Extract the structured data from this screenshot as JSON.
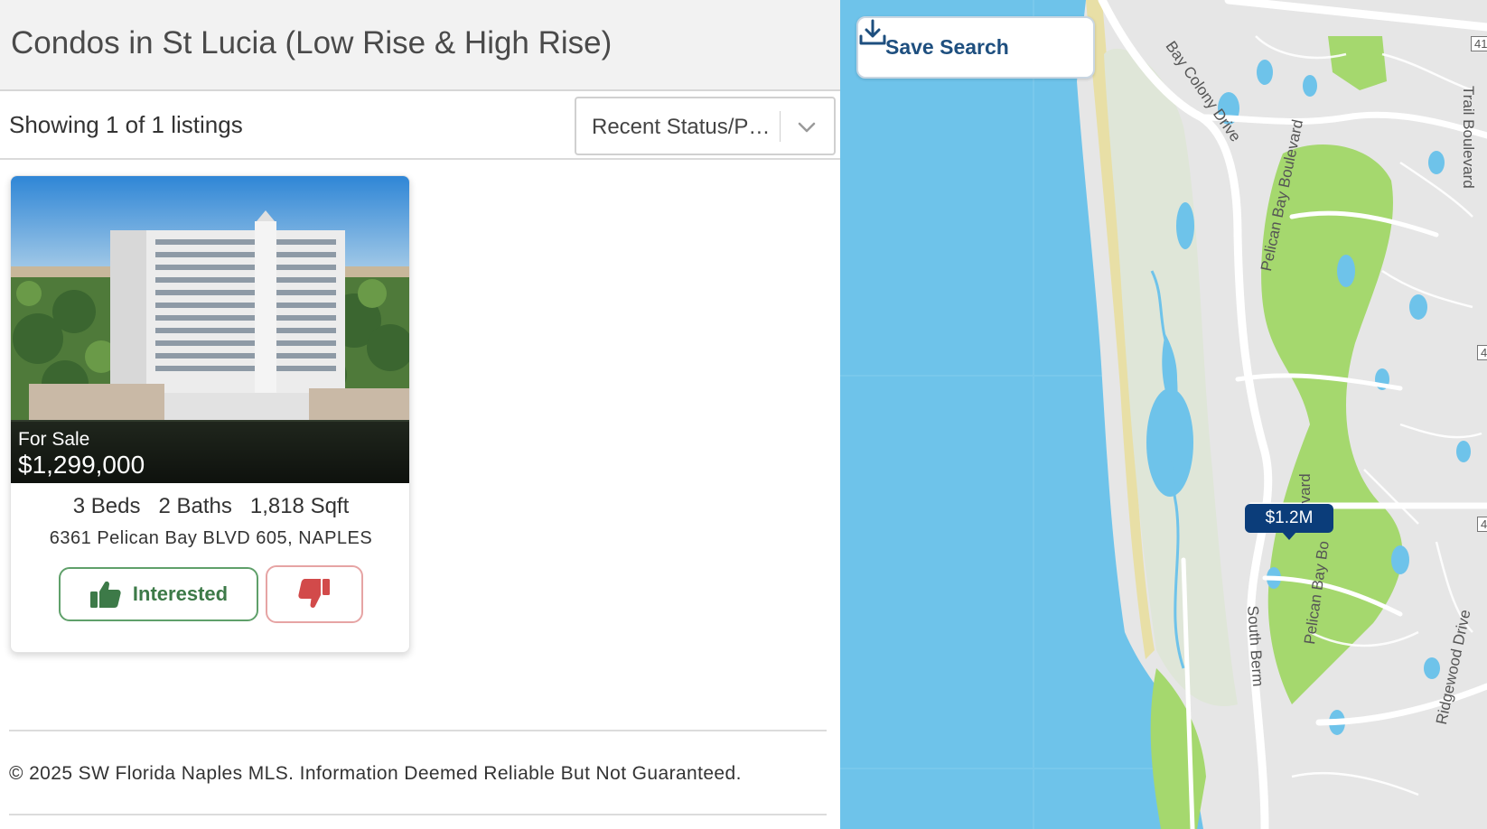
{
  "header": {
    "title": "Condos in St Lucia (Low Rise & High Rise)"
  },
  "toolbar": {
    "listing_count": "Showing 1 of 1 listings",
    "sort_value": "Recent Status/P…"
  },
  "listing": {
    "status": "For Sale",
    "price": "$1,299,000",
    "beds": "3 Beds",
    "baths": "2 Baths",
    "sqft": "1,818 Sqft",
    "address": "6361 Pelican Bay BLVD 605, NAPLES",
    "interested_label": "Interested"
  },
  "footer": {
    "disclaimer": "© 2025 SW Florida Naples MLS. Information Deemed Reliable But Not Guaranteed."
  },
  "map": {
    "save_search_label": "Save Search",
    "price_pin": "$1.2M",
    "labels": {
      "bay_colony": "Bay Colony Drive",
      "pelican_bay_north": "Pelican Bay Boulevard",
      "pelican_bay_south": "Pelican Bay Bo",
      "boulevard_fragment": "ulevard",
      "south_berm": "South Berm",
      "ridgewood": "Ridgewood Drive",
      "trail_blvd": "Trail Boulevard",
      "shield_41": "41",
      "shield_4_mid": "4",
      "shield_4_low": "4"
    },
    "colors": {
      "water": "#6ec3ea",
      "land": "#e6e6e6",
      "park": "#a5d86e",
      "preserve": "#dfe6d8",
      "road": "#ffffff",
      "pin": "#0b3d7a"
    }
  },
  "icons": {
    "sort": "chevron-down-icon",
    "interested": "thumbs-up-icon",
    "dislike": "thumbs-down-icon",
    "save": "download-icon"
  }
}
